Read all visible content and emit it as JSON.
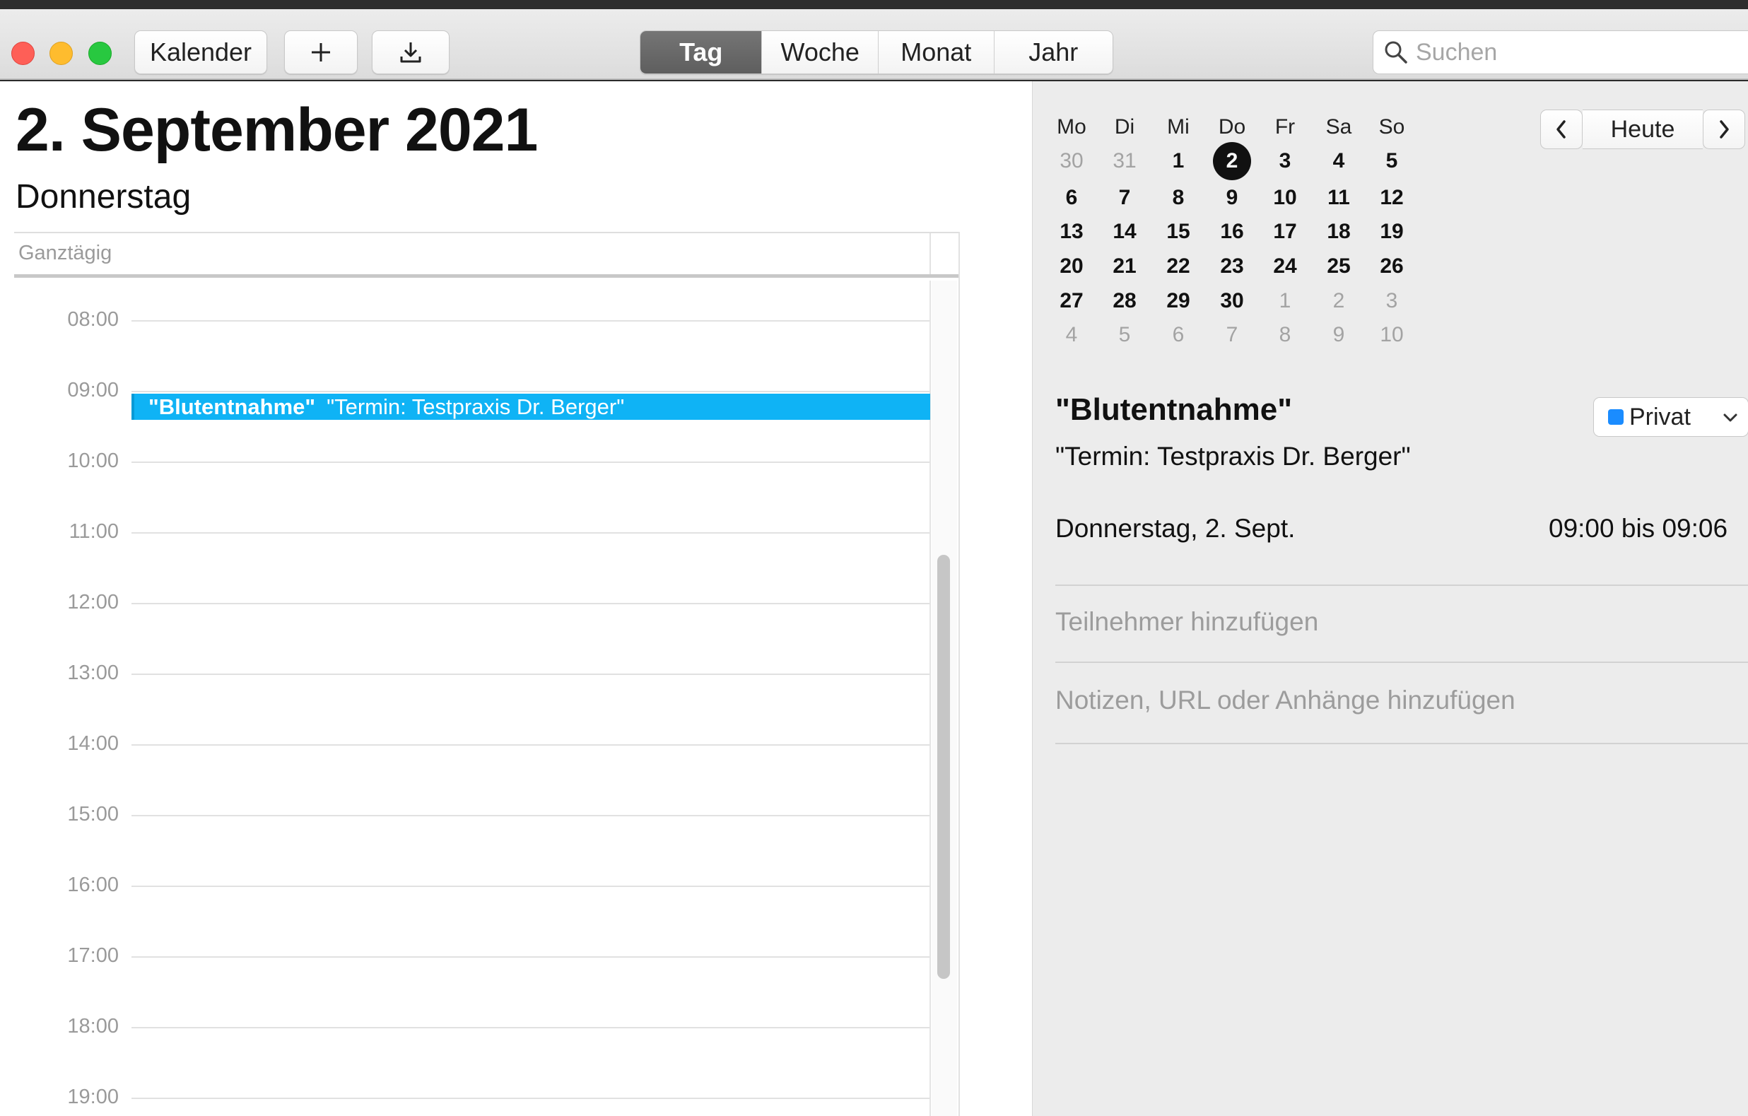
{
  "toolbar": {
    "calendar_button": "Kalender",
    "add_icon": "plus-icon",
    "import_icon": "download-icon",
    "view_tabs": [
      {
        "label": "Tag",
        "active": true
      },
      {
        "label": "Woche",
        "active": false
      },
      {
        "label": "Monat",
        "active": false
      },
      {
        "label": "Jahr",
        "active": false
      }
    ],
    "search_placeholder": "Suchen"
  },
  "day_view": {
    "date_title": "2. September 2021",
    "weekday": "Donnerstag",
    "allday_label": "Ganztägig",
    "hours": [
      "08:00",
      "09:00",
      "10:00",
      "11:00",
      "12:00",
      "13:00",
      "14:00",
      "15:00",
      "16:00",
      "17:00",
      "18:00",
      "19:00"
    ],
    "event": {
      "title": "\"Blutentnahme\"",
      "location": "\"Termin: Testpraxis Dr. Berger\"",
      "color": "#0fb3f5"
    }
  },
  "mini_calendar": {
    "weekday_headers": [
      "Mo",
      "Di",
      "Mi",
      "Do",
      "Fr",
      "Sa",
      "So"
    ],
    "weeks": [
      [
        {
          "d": "30",
          "m": true
        },
        {
          "d": "31",
          "m": true
        },
        {
          "d": "1"
        },
        {
          "d": "2",
          "today": true
        },
        {
          "d": "3"
        },
        {
          "d": "4"
        },
        {
          "d": "5"
        }
      ],
      [
        {
          "d": "6"
        },
        {
          "d": "7"
        },
        {
          "d": "8"
        },
        {
          "d": "9"
        },
        {
          "d": "10"
        },
        {
          "d": "11"
        },
        {
          "d": "12"
        }
      ],
      [
        {
          "d": "13"
        },
        {
          "d": "14"
        },
        {
          "d": "15"
        },
        {
          "d": "16"
        },
        {
          "d": "17"
        },
        {
          "d": "18"
        },
        {
          "d": "19"
        }
      ],
      [
        {
          "d": "20"
        },
        {
          "d": "21"
        },
        {
          "d": "22"
        },
        {
          "d": "23"
        },
        {
          "d": "24"
        },
        {
          "d": "25"
        },
        {
          "d": "26"
        }
      ],
      [
        {
          "d": "27"
        },
        {
          "d": "28"
        },
        {
          "d": "29"
        },
        {
          "d": "30"
        },
        {
          "d": "1",
          "m": true
        },
        {
          "d": "2",
          "m": true
        },
        {
          "d": "3",
          "m": true
        }
      ],
      [
        {
          "d": "4",
          "m": true
        },
        {
          "d": "5",
          "m": true
        },
        {
          "d": "6",
          "m": true
        },
        {
          "d": "7",
          "m": true
        },
        {
          "d": "8",
          "m": true
        },
        {
          "d": "9",
          "m": true
        },
        {
          "d": "10",
          "m": true
        }
      ]
    ],
    "prev_icon": "chevron-left-icon",
    "next_icon": "chevron-right-icon",
    "today_button": "Heute"
  },
  "inspector": {
    "title": "\"Blutentnahme\"",
    "location": "\"Termin: Testpraxis Dr. Berger\"",
    "calendar_name": "Privat",
    "calendar_color": "#1a8cff",
    "date": "Donnerstag, 2. Sept.",
    "time": "09:00 bis 09:06",
    "invitees_placeholder": "Teilnehmer hinzufügen",
    "notes_placeholder": "Notizen, URL oder Anhänge hinzufügen"
  }
}
